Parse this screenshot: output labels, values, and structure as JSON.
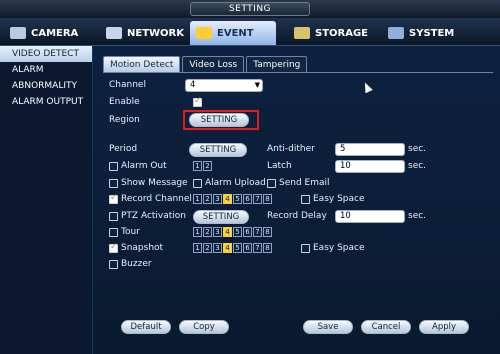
{
  "title": "SETTING",
  "nav": [
    {
      "label": "CAMERA",
      "icon": "camera-icon"
    },
    {
      "label": "NETWORK",
      "icon": "network-icon"
    },
    {
      "label": "EVENT",
      "icon": "event-icon"
    },
    {
      "label": "STORAGE",
      "icon": "storage-icon"
    },
    {
      "label": "SYSTEM",
      "icon": "system-icon"
    }
  ],
  "sidebar": [
    "VIDEO DETECT",
    "ALARM",
    "ABNORMALITY",
    "ALARM OUTPUT"
  ],
  "tabs": [
    "Motion Detect",
    "Video Loss",
    "Tampering"
  ],
  "form": {
    "channel_label": "Channel",
    "channel_value": "4",
    "enable_label": "Enable",
    "region_label": "Region",
    "region_button": "SETTING",
    "period_label": "Period",
    "period_button": "SETTING",
    "antidither_label": "Anti-dither",
    "antidither_value": "5",
    "sec": "sec.",
    "alarm_out_label": "Alarm Out",
    "latch_label": "Latch",
    "latch_value": "10",
    "show_message": "Show Message",
    "alarm_upload": "Alarm Upload",
    "send_email": "Send Email",
    "record_channel": "Record Channel",
    "easy_space": "Easy Space",
    "ptz_activation": "PTZ Activation",
    "ptz_button": "SETTING",
    "record_delay_label": "Record Delay",
    "record_delay_value": "10",
    "tour": "Tour",
    "snapshot": "Snapshot",
    "buzzer": "Buzzer",
    "alarm_outs": [
      "1",
      "2"
    ],
    "channels": [
      "1",
      "2",
      "3",
      "4",
      "5",
      "6",
      "7",
      "8"
    ]
  },
  "footer": {
    "default": "Default",
    "copy": "Copy",
    "save": "Save",
    "cancel": "Cancel",
    "apply": "Apply"
  },
  "colors": {
    "highlight": "#e21c1c",
    "active_channel": "#f7d046"
  }
}
